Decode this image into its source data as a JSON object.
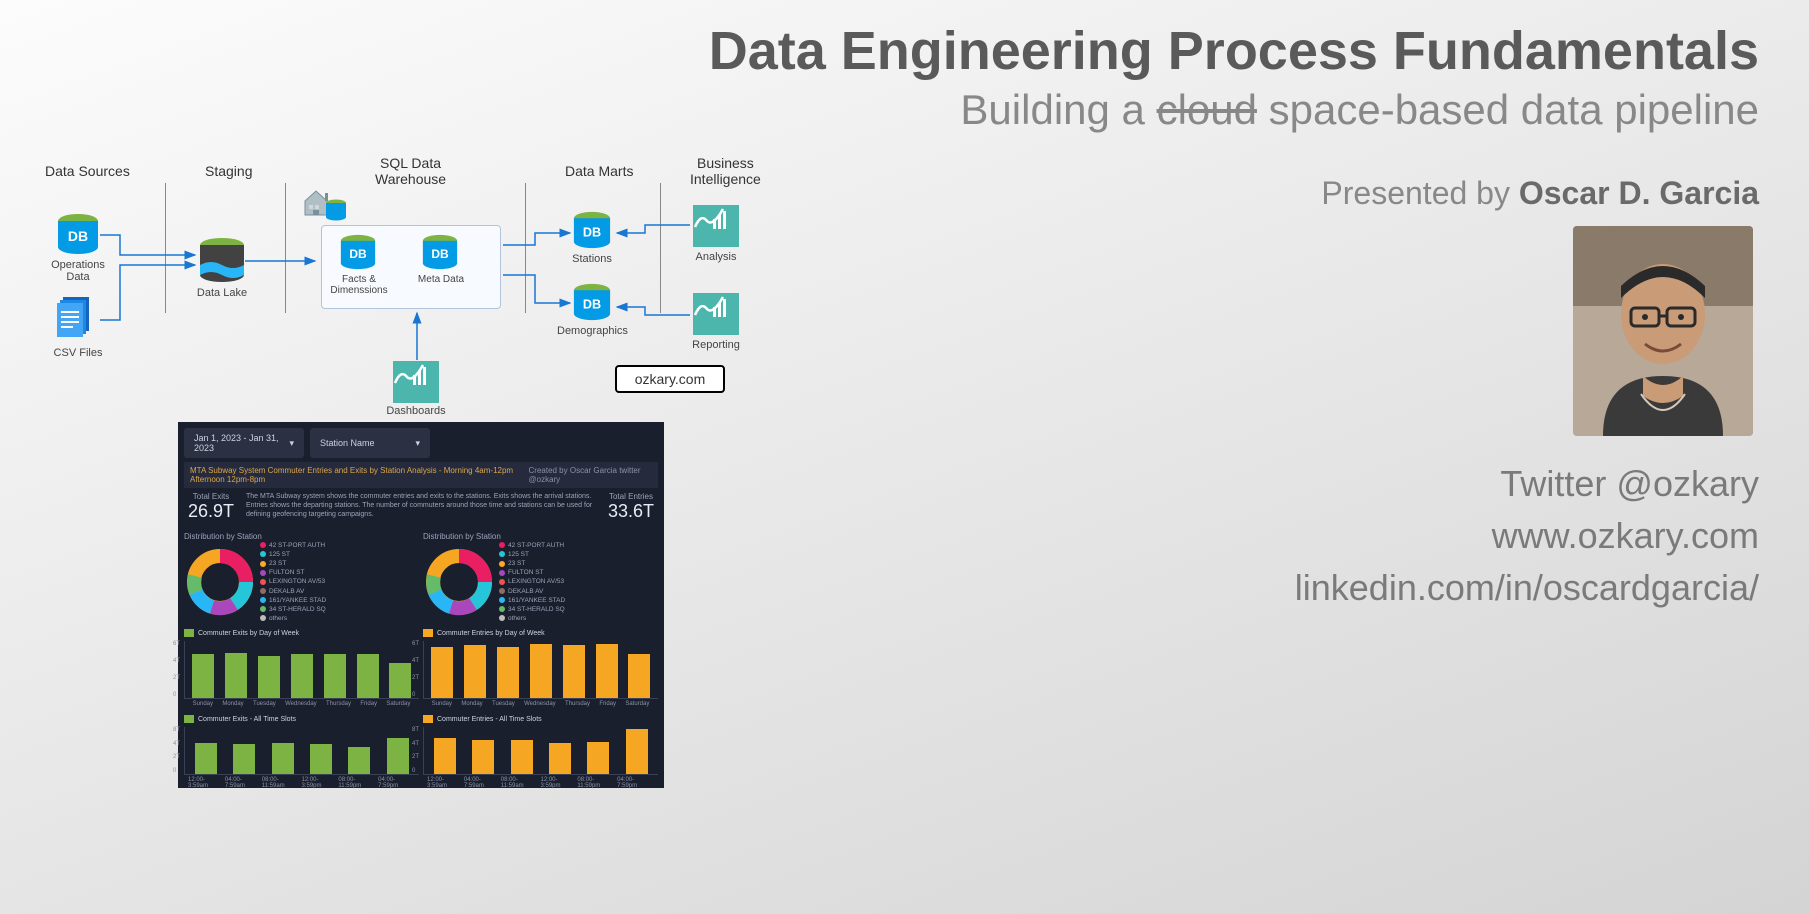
{
  "header": {
    "title": "Data Engineering Process Fundamentals",
    "subtitle_prefix": "Building a ",
    "subtitle_strike": "cloud",
    "subtitle_suffix": " space-based data pipeline",
    "presented_by_label": "Presented by ",
    "presenter": "Oscar D. Garcia"
  },
  "contact": {
    "twitter": "Twitter @ozkary",
    "website": "www.ozkary.com",
    "linkedin": "linkedin.com/in/oscardgarcia/"
  },
  "architecture": {
    "columns": {
      "sources": "Data Sources",
      "staging": "Staging",
      "warehouse": "SQL Data\nWarehouse",
      "marts": "Data Marts",
      "bi": "Business\nIntelligence"
    },
    "nodes": {
      "operations_data": "Operations Data",
      "csv_files": "CSV Files",
      "data_lake": "Data Lake",
      "facts": "Facts &\nDimenssions",
      "meta": "Meta Data",
      "stations": "Stations",
      "demographics": "Demographics",
      "analysis": "Analysis",
      "reporting": "Reporting",
      "dashboards": "Dashboards"
    },
    "url_box": "ozkary.com"
  },
  "dashboard": {
    "date_range": "Jan 1, 2023 - Jan 31, 2023",
    "station_select": "Station Name",
    "title_left": "MTA Subway System Commuter Entries and Exits by Station Analysis - Morning 4am-12pm Afternoon 12pm-8pm",
    "title_right": "Created by Oscar Garcia twitter @ozkary",
    "description": "The MTA Subway system shows the commuter entries and exits to the stations. Exits shows the arrival stations. Entries shows the departing stations. The number of commuters around those time and stations can be used for defining geofencing targeting campaigns.",
    "exits": {
      "label": "Total Exits",
      "value": "26.9T"
    },
    "entries": {
      "label": "Total Entries",
      "value": "33.6T"
    },
    "dist_label": "Distribution by Station",
    "legend_items": [
      {
        "c": "#e91e63",
        "t": "42 ST-PORT AUTH"
      },
      {
        "c": "#26c6da",
        "t": "125 ST"
      },
      {
        "c": "#ffa726",
        "t": "23 ST"
      },
      {
        "c": "#ab47bc",
        "t": "FULTON ST"
      },
      {
        "c": "#ef5350",
        "t": "LEXINGTON AV/53"
      },
      {
        "c": "#8d6e63",
        "t": "DEKALB AV"
      },
      {
        "c": "#29b6f6",
        "t": "161/YANKEE STAD"
      },
      {
        "c": "#66bb6a",
        "t": "34 ST-HERALD SQ"
      },
      {
        "c": "#bdbdbd",
        "t": "others"
      }
    ],
    "exits_by_day": {
      "title": "Commuter Exits by Day of Week",
      "cats": [
        "Sunday",
        "Monday",
        "Tuesday",
        "Wednesday",
        "Thursday",
        "Friday",
        "Saturday"
      ],
      "vals": [
        42,
        43,
        41,
        42,
        42,
        42,
        34
      ]
    },
    "entries_by_day": {
      "title": "Commuter Entries by Day of Week",
      "cats": [
        "Sunday",
        "Monday",
        "Tuesday",
        "Wednesday",
        "Thursday",
        "Friday",
        "Saturday"
      ],
      "vals": [
        49,
        51,
        49,
        52,
        51,
        52,
        42
      ]
    },
    "exits_slots": {
      "title": "Commuter Exits - All Time Slots",
      "cats": [
        "12:00-3:59am",
        "04:00-7:59am",
        "08:00-11:59am",
        "12:00-3:59pm",
        "08:00-11:59pm",
        "04:00-7:59pm"
      ],
      "vals": [
        43,
        42,
        43,
        42,
        37,
        50
      ]
    },
    "entries_slots": {
      "title": "Commuter Entries - All Time Slots",
      "cats": [
        "12:00-3:59am",
        "04:00-7:59am",
        "08:00-11:59am",
        "12:00-3:59pm",
        "08:00-11:59pm",
        "04:00-7:59pm"
      ],
      "vals": [
        50,
        47,
        47,
        43,
        44,
        62
      ]
    },
    "yticks_day": [
      "6T",
      "4T",
      "2T",
      "0"
    ],
    "yticks_slot": [
      "8T",
      "4T",
      "2T",
      "0"
    ]
  },
  "chart_data": [
    {
      "type": "bar",
      "title": "Commuter Exits by Day of Week",
      "categories": [
        "Sunday",
        "Monday",
        "Tuesday",
        "Wednesday",
        "Thursday",
        "Friday",
        "Saturday"
      ],
      "values": [
        4.2,
        4.3,
        4.1,
        4.2,
        4.2,
        4.2,
        3.4
      ],
      "ylabel": "T",
      "ylim": [
        0,
        6
      ]
    },
    {
      "type": "bar",
      "title": "Commuter Entries by Day of Week",
      "categories": [
        "Sunday",
        "Monday",
        "Tuesday",
        "Wednesday",
        "Thursday",
        "Friday",
        "Saturday"
      ],
      "values": [
        4.9,
        5.1,
        4.9,
        5.2,
        5.1,
        5.2,
        4.2
      ],
      "ylabel": "T",
      "ylim": [
        0,
        6
      ]
    },
    {
      "type": "bar",
      "title": "Commuter Exits - All Time Slots",
      "categories": [
        "12:00-3:59am",
        "04:00-7:59am",
        "08:00-11:59am",
        "12:00-3:59pm",
        "08:00-11:59pm",
        "04:00-7:59pm"
      ],
      "values": [
        4.3,
        4.2,
        4.3,
        4.2,
        3.7,
        5.0
      ],
      "ylabel": "T",
      "ylim": [
        0,
        8
      ]
    },
    {
      "type": "bar",
      "title": "Commuter Entries - All Time Slots",
      "categories": [
        "12:00-3:59am",
        "04:00-7:59am",
        "08:00-11:59am",
        "12:00-3:59pm",
        "08:00-11:59pm",
        "04:00-7:59pm"
      ],
      "values": [
        5.0,
        4.7,
        4.7,
        4.3,
        4.4,
        6.2
      ],
      "ylabel": "T",
      "ylim": [
        0,
        8
      ]
    },
    {
      "type": "pie",
      "title": "Exits Distribution by Station",
      "categories": [
        "42 ST-PORT AUTH",
        "125 ST",
        "23 ST",
        "FULTON ST",
        "LEXINGTON AV/53",
        "DEKALB AV",
        "161/YANKEE STAD",
        "34 ST-HERALD SQ",
        "others"
      ],
      "values": [
        13,
        11,
        10,
        9,
        8,
        7,
        6,
        5,
        31
      ]
    },
    {
      "type": "pie",
      "title": "Entries Distribution by Station",
      "categories": [
        "42 ST-PORT AUTH",
        "125 ST",
        "23 ST",
        "FULTON ST",
        "LEXINGTON AV/53",
        "DEKALB AV",
        "161/YANKEE STAD",
        "34 ST-HERALD SQ",
        "others"
      ],
      "values": [
        13,
        11,
        10,
        9,
        8,
        7,
        6,
        5,
        31
      ]
    }
  ]
}
